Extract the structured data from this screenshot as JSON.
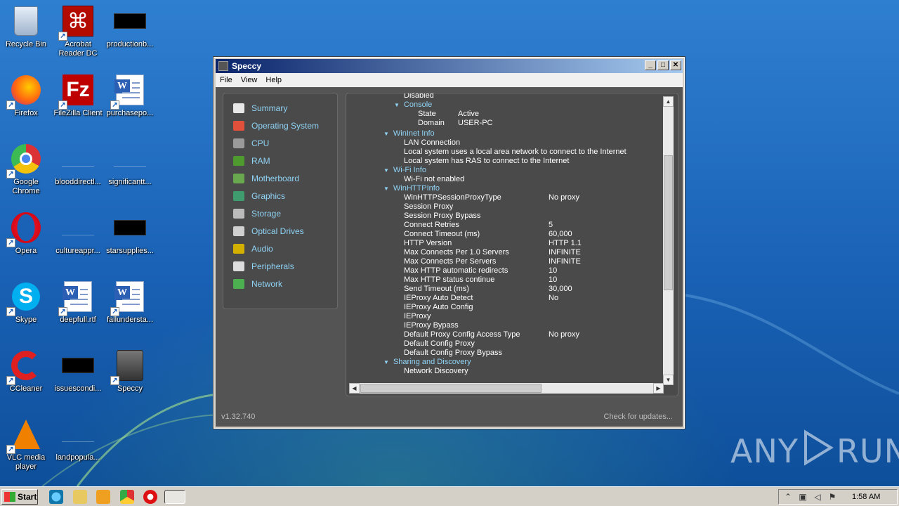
{
  "desktop": {
    "icons": [
      {
        "label": "Recycle Bin"
      },
      {
        "label": "Acrobat Reader DC"
      },
      {
        "label": "productionb..."
      },
      {
        "label": "Firefox"
      },
      {
        "label": "FileZilla Client"
      },
      {
        "label": "purchasepo..."
      },
      {
        "label": "Google Chrome"
      },
      {
        "label": "blooddirectl..."
      },
      {
        "label": "significantt..."
      },
      {
        "label": "Opera"
      },
      {
        "label": "cultureappr..."
      },
      {
        "label": "starsupplies..."
      },
      {
        "label": "Skype"
      },
      {
        "label": "deepfull.rtf"
      },
      {
        "label": "fallundersta..."
      },
      {
        "label": "CCleaner"
      },
      {
        "label": "issuescondi..."
      },
      {
        "label": "Speccy"
      },
      {
        "label": "VLC media player"
      },
      {
        "label": "landpopula..."
      }
    ]
  },
  "window": {
    "title": "Speccy",
    "controls": {
      "minimize": "_",
      "maximize": "□",
      "close": "✕"
    },
    "menu": [
      "File",
      "View",
      "Help"
    ],
    "nav": [
      {
        "label": "Summary",
        "icon": "summary-icon",
        "color": "#e8e8e8"
      },
      {
        "label": "Operating System",
        "icon": "windows-icon",
        "color": "#e0503a"
      },
      {
        "label": "CPU",
        "icon": "cpu-icon",
        "color": "#9a9a9a"
      },
      {
        "label": "RAM",
        "icon": "ram-icon",
        "color": "#4e9a2e"
      },
      {
        "label": "Motherboard",
        "icon": "motherboard-icon",
        "color": "#6aa84f"
      },
      {
        "label": "Graphics",
        "icon": "graphics-icon",
        "color": "#3f9c6e"
      },
      {
        "label": "Storage",
        "icon": "storage-icon",
        "color": "#bbbbbb"
      },
      {
        "label": "Optical Drives",
        "icon": "optical-drive-icon",
        "color": "#d0d0d0"
      },
      {
        "label": "Audio",
        "icon": "audio-icon",
        "color": "#d4b000"
      },
      {
        "label": "Peripherals",
        "icon": "peripherals-icon",
        "color": "#dddddd"
      },
      {
        "label": "Network",
        "icon": "network-icon",
        "color": "#4caf50"
      }
    ],
    "tree": [
      {
        "t": "Disabled",
        "v": "",
        "indent": 2,
        "hdr": false
      },
      {
        "t": "Console",
        "v": "",
        "indent": 2,
        "hdr": true
      },
      {
        "t": "State",
        "v": "Active",
        "indent": 3,
        "hdr": false
      },
      {
        "t": "Domain",
        "v": "USER-PC",
        "indent": 3,
        "hdr": false
      },
      {
        "t": "WinInet Info",
        "v": "",
        "indent": 1,
        "hdr": true
      },
      {
        "t": "LAN Connection",
        "v": "",
        "indent": 2,
        "hdr": false
      },
      {
        "t": "Local system uses a local area network to connect to the Internet",
        "v": "",
        "indent": 2,
        "hdr": false
      },
      {
        "t": "Local system has RAS to connect to the Internet",
        "v": "",
        "indent": 2,
        "hdr": false
      },
      {
        "t": "Wi-Fi Info",
        "v": "",
        "indent": 1,
        "hdr": true
      },
      {
        "t": "Wi-Fi not enabled",
        "v": "",
        "indent": 2,
        "hdr": false
      },
      {
        "t": "WinHTTPInfo",
        "v": "",
        "indent": 1,
        "hdr": true
      },
      {
        "t": "WinHTTPSessionProxyType",
        "v": "No proxy",
        "indent": 2,
        "hdr": false
      },
      {
        "t": "Session Proxy",
        "v": "",
        "indent": 2,
        "hdr": false
      },
      {
        "t": "Session Proxy Bypass",
        "v": "",
        "indent": 2,
        "hdr": false
      },
      {
        "t": "Connect Retries",
        "v": "5",
        "indent": 2,
        "hdr": false
      },
      {
        "t": "Connect Timeout (ms)",
        "v": "60,000",
        "indent": 2,
        "hdr": false
      },
      {
        "t": "HTTP Version",
        "v": "HTTP 1.1",
        "indent": 2,
        "hdr": false
      },
      {
        "t": "Max Connects Per 1.0 Servers",
        "v": "INFINITE",
        "indent": 2,
        "hdr": false
      },
      {
        "t": "Max Connects Per Servers",
        "v": "INFINITE",
        "indent": 2,
        "hdr": false
      },
      {
        "t": "Max HTTP automatic redirects",
        "v": "10",
        "indent": 2,
        "hdr": false
      },
      {
        "t": "Max HTTP status continue",
        "v": "10",
        "indent": 2,
        "hdr": false
      },
      {
        "t": "Send Timeout (ms)",
        "v": "30,000",
        "indent": 2,
        "hdr": false
      },
      {
        "t": "IEProxy Auto Detect",
        "v": "No",
        "indent": 2,
        "hdr": false
      },
      {
        "t": "IEProxy Auto Config",
        "v": "",
        "indent": 2,
        "hdr": false
      },
      {
        "t": "IEProxy",
        "v": "",
        "indent": 2,
        "hdr": false
      },
      {
        "t": "IEProxy Bypass",
        "v": "",
        "indent": 2,
        "hdr": false
      },
      {
        "t": "Default Proxy Config Access Type",
        "v": "No proxy",
        "indent": 2,
        "hdr": false
      },
      {
        "t": "Default Config Proxy",
        "v": "",
        "indent": 2,
        "hdr": false
      },
      {
        "t": "Default Config Proxy Bypass",
        "v": "",
        "indent": 2,
        "hdr": false
      },
      {
        "t": "Sharing and Discovery",
        "v": "",
        "indent": 1,
        "hdr": true
      },
      {
        "t": "Network Discovery",
        "v": "",
        "indent": 2,
        "hdr": false
      }
    ],
    "version": "v1.32.740",
    "check_updates": "Check for updates..."
  },
  "watermark": {
    "left": "ANY",
    "right": "RUN"
  },
  "taskbar": {
    "start_label": "Start",
    "clock": "1:58 AM"
  }
}
